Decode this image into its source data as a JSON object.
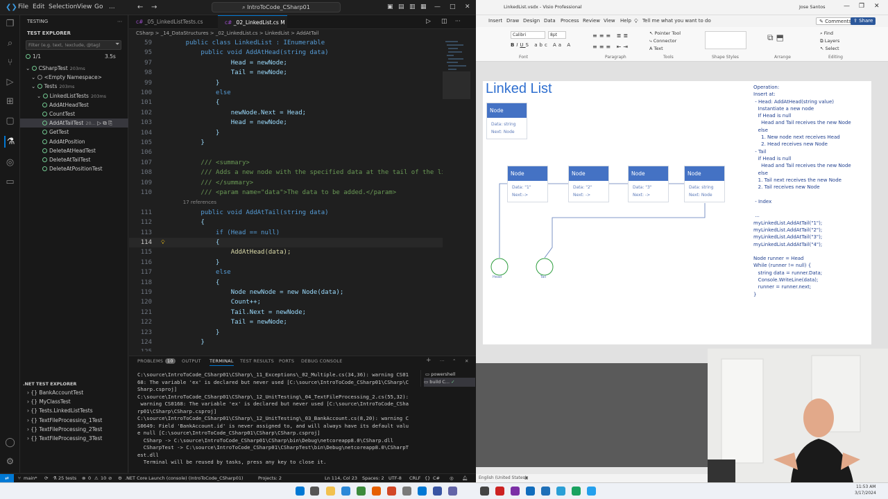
{
  "vscode": {
    "title": "IntroToCode_CSharp01",
    "menu": [
      "File",
      "Edit",
      "Selection",
      "View",
      "Go",
      "..."
    ],
    "sidebar": {
      "header": "TESTING",
      "section": "TEST EXPLORER",
      "filter_placeholder": "Filter (e.g. text, !exclude, @tag)",
      "summary": "1/1",
      "summary_time": "3.5s",
      "tree": [
        {
          "label": "CSharpTest",
          "dur": "203ms",
          "indent": 0
        },
        {
          "label": "<Empty Namespace>",
          "dur": "",
          "indent": 1
        },
        {
          "label": "Tests",
          "dur": "203ms",
          "indent": 1
        },
        {
          "label": "LinkedListTests",
          "dur": "203ms",
          "indent": 2
        },
        {
          "label": "AddAtHeadTest",
          "dur": "",
          "indent": 3
        },
        {
          "label": "CountTest",
          "dur": "",
          "indent": 3
        },
        {
          "label": "AddAtTailTest",
          "dur": "20...",
          "indent": 3
        },
        {
          "label": "GetTest",
          "dur": "",
          "indent": 3
        },
        {
          "label": "AddAtPosition",
          "dur": "",
          "indent": 3
        },
        {
          "label": "DeleteAtHeadTest",
          "dur": "",
          "indent": 3
        },
        {
          "label": "DeleteAtTailTest",
          "dur": "",
          "indent": 3
        },
        {
          "label": "DeleteAtPositionTest",
          "dur": "",
          "indent": 3
        }
      ],
      "dotnet_header": ".NET TEST EXPLORER",
      "dotnet_items": [
        "BankAccountTest",
        "MyClassTest",
        "Tests.LinkedListTests",
        "TextFileProcessing_1Test",
        "TextFileProcessing_2Test",
        "TextFileProcessing_3Test"
      ]
    },
    "tabs": [
      "_05_LinkedListTests.cs",
      "_02_LinkedList.cs  M"
    ],
    "breadcrumb": "CSharp > _14_DataStructures > _02_LinkedList.cs > LinkedList > AddAtTail",
    "code": [
      {
        "n": "59",
        "t": "    public class LinkedList : IEnumerable"
      },
      {
        "n": "95",
        "t": "        public void AddAtHead(string data)"
      },
      {
        "n": "97",
        "t": "                Head = newNode;"
      },
      {
        "n": "98",
        "t": "                Tail = newNode;"
      },
      {
        "n": "99",
        "t": "            }"
      },
      {
        "n": "100",
        "t": "            else"
      },
      {
        "n": "101",
        "t": "            {"
      },
      {
        "n": "102",
        "t": "                newNode.Next = Head;"
      },
      {
        "n": "103",
        "t": "                Head = newNode;"
      },
      {
        "n": "104",
        "t": "            }"
      },
      {
        "n": "105",
        "t": "        }"
      },
      {
        "n": "106",
        "t": ""
      },
      {
        "n": "107",
        "t": "        /// <summary>"
      },
      {
        "n": "108",
        "t": "        /// Adds a new node with the specified data at the tail of the lin"
      },
      {
        "n": "109",
        "t": "        /// </summary>"
      },
      {
        "n": "110",
        "t": "        /// <param name=\"data\">The data to be added.</param>"
      },
      {
        "n": "",
        "t": "        17 references"
      },
      {
        "n": "111",
        "t": "        public void AddAtTail(string data)"
      },
      {
        "n": "112",
        "t": "        {"
      },
      {
        "n": "113",
        "t": "            if (Head == null)"
      },
      {
        "n": "114",
        "t": "            {"
      },
      {
        "n": "115",
        "t": "                AddAtHead(data);"
      },
      {
        "n": "116",
        "t": "            }"
      },
      {
        "n": "117",
        "t": "            else"
      },
      {
        "n": "118",
        "t": "            {"
      },
      {
        "n": "119",
        "t": "                Node newNode = new Node(data);"
      },
      {
        "n": "120",
        "t": "                Count++;"
      },
      {
        "n": "121",
        "t": "                Tail.Next = newNode;"
      },
      {
        "n": "122",
        "t": "                Tail = newNode;"
      },
      {
        "n": "123",
        "t": "            }"
      },
      {
        "n": "124",
        "t": "        }"
      },
      {
        "n": "125",
        "t": ""
      }
    ],
    "panel_tabs": [
      "PROBLEMS",
      "10",
      "OUTPUT",
      "TERMINAL",
      "TEST RESULTS",
      "PORTS",
      "DEBUG CONSOLE"
    ],
    "terminal": [
      "C:\\source\\IntroToCode_CSharp01\\CSharp\\_11_Exceptions\\_02_Multiple.cs(34,36): warning CS01",
      "68: The variable 'ex' is declared but never used [C:\\source\\IntroToCode_CSharp01\\CSharp\\C",
      "Sharp.csproj]",
      "C:\\source\\IntroToCode_CSharp01\\CSharp\\_12_UnitTesting\\_04_TextFileProcessing_2.cs(55,32):",
      " warning CS0168: The variable 'ex' is declared but never used [C:\\source\\IntroToCode_CSha",
      "rp01\\CSharp\\CSharp.csproj]",
      "C:\\source\\IntroToCode_CSharp01\\CSharp\\_12_UnitTesting\\_03_BankAccount.cs(8,20): warning C",
      "S0649: Field 'BankAccount.id' is never assigned to, and will always have its default valu",
      "e null [C:\\source\\IntroToCode_CSharp01\\CSharp\\CSharp.csproj]",
      "  CSharp -> C:\\source\\IntroToCode_CSharp01\\CSharp\\bin\\Debug\\netcoreapp8.0\\CSharp.dll",
      "  CSharpTest -> C:\\source\\IntroToCode_CSharp01\\CSharpTest\\bin\\Debug\\netcoreapp8.0\\CSharpT",
      "est.dll",
      "  Terminal will be reused by tasks, press any key to close it."
    ],
    "terminals": [
      "powershell",
      "build C..."
    ],
    "status": {
      "branch": "main*",
      "tests": "25 tests",
      "errors": "0",
      "warnings": "10",
      "launch": ".NET Core Launch (console) (IntroToCode_CSharp01)",
      "projects": "Projects: 2",
      "position": "Ln 114, Col 23",
      "spaces": "Spaces: 2",
      "encoding": "UTF-8",
      "eol": "CRLF",
      "lang": "C#"
    }
  },
  "visio": {
    "title": "LinkedList.vsdx - Visio Professional",
    "user": "Jose Santos",
    "ribbon_tabs": [
      "Insert",
      "Draw",
      "Design",
      "Data",
      "Process",
      "Review",
      "View",
      "Help",
      "Tell me what you want to do"
    ],
    "ribbon_buttons": [
      "Comments",
      "Share"
    ],
    "font": "Calibri",
    "font_size": "8pt",
    "tools": [
      "Pointer Tool",
      "Connector",
      "Text"
    ],
    "groups": [
      "Font",
      "Paragraph",
      "Tools",
      "Shape Styles",
      "Arrange",
      "Editing"
    ],
    "page_title": "Linked List",
    "legend_node": {
      "header": "Node",
      "f1": "Data: string",
      "f2": "Next: Node"
    },
    "nodes": [
      {
        "header": "Node",
        "f1": "Data: \"1\"",
        "f2": "Next:->"
      },
      {
        "header": "Node",
        "f1": "Data: \"2\"",
        "f2": "Next: ->"
      },
      {
        "header": "Node",
        "f1": "Data: \"3\"",
        "f2": "Next: ->"
      },
      {
        "header": "Node",
        "f1": "Data: string",
        "f2": "Next: Node"
      }
    ],
    "circles": [
      "Head",
      "Tail"
    ],
    "notes": "Operation:\nInsert at:\n - Head: AddAtHead(string value)\n   Instantiate a new node\n   If Head is null\n     Head and Tail receives the new Node\n   else\n     1. New node next receives Head\n     2. Head receives new Node\n - Tail\n   if Head is null\n     Head and Tail receives the new Node\n   else\n   1. Tail next receives the new Node\n   2. Tail receives new Node\n\n - Index\n\n ...\nmyLinkedList.AddAtTail(\"1\");\nmyLinkedList.AddAtTail(\"2\");\nmyLinkedList.AddAtTail(\"3\");\nmyLinkedList.AddAtTail(\"4\");\n\nNode runner = Head\nWhile (runner != null) {\n   string data = runner.Data;\n   Console.WriteLine(data);\n   runner = runner.next;\n}",
    "status": "English (United States)"
  },
  "taskbar": {
    "time": "11:53 AM",
    "date": "3/17/2024"
  }
}
